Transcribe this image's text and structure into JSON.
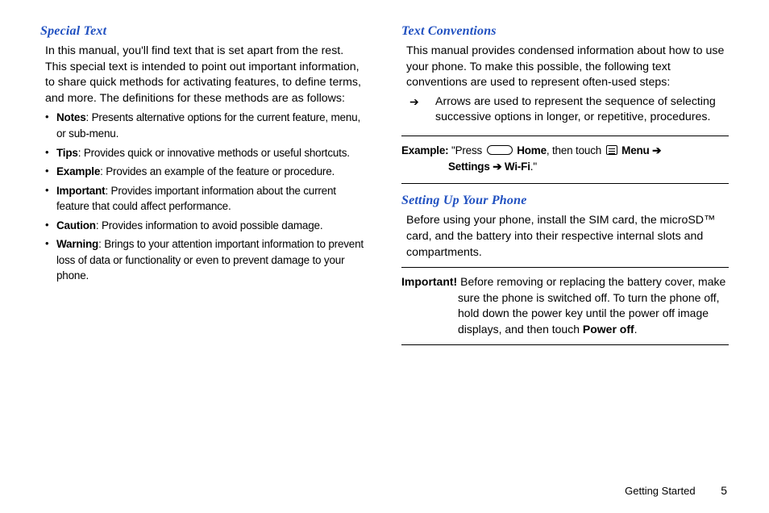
{
  "left": {
    "heading": "Special Text",
    "intro": "In this manual, you'll find text that is set apart from the rest. This special text is intended to point out important information, to share quick methods for activating features, to define terms, and more. The definitions for these methods are as follows:",
    "items": [
      {
        "term": "Notes",
        "desc": ": Presents alternative options for the current feature, menu, or sub-menu."
      },
      {
        "term": "Tips",
        "desc": ": Provides quick or innovative methods or useful shortcuts."
      },
      {
        "term": "Example",
        "desc": ": Provides an example of the feature or procedure."
      },
      {
        "term": "Important",
        "desc": ": Provides important information about the current feature that could affect performance."
      },
      {
        "term": "Caution",
        "desc": ": Provides information to avoid possible damage."
      },
      {
        "term": "Warning",
        "desc": ": Brings to your attention important information to prevent loss of data or functionality or even to prevent damage to your phone."
      }
    ]
  },
  "right": {
    "section1": {
      "heading": "Text Conventions",
      "intro": "This manual provides condensed information about how to use your phone. To make this possible, the following text conventions are used to represent often-used steps:",
      "arrow_glyph": "➔",
      "arrow_text": "Arrows are used to represent the sequence of selecting successive options in longer, or repetitive, procedures."
    },
    "example": {
      "label": "Example:",
      "pre": " \"Press ",
      "home": " Home",
      "mid": ", then touch ",
      "menu": " Menu ",
      "arrow1": "➔",
      "settings": "Settings ",
      "arrow2": "➔",
      "wifi": " Wi-Fi",
      "tail": ".\""
    },
    "section2": {
      "heading": "Setting Up Your Phone",
      "intro": "Before using your phone, install the SIM card, the microSD™ card, and the battery into their respective internal slots and compartments."
    },
    "important": {
      "label": "Important!",
      "text_a": " Before removing or replacing the battery cover, make sure the phone is switched off. To turn the phone off, hold down the power key until the power off image displays, and then touch ",
      "poweroff": "Power off",
      "text_b": "."
    }
  },
  "footer": {
    "section": "Getting Started",
    "page": "5"
  }
}
